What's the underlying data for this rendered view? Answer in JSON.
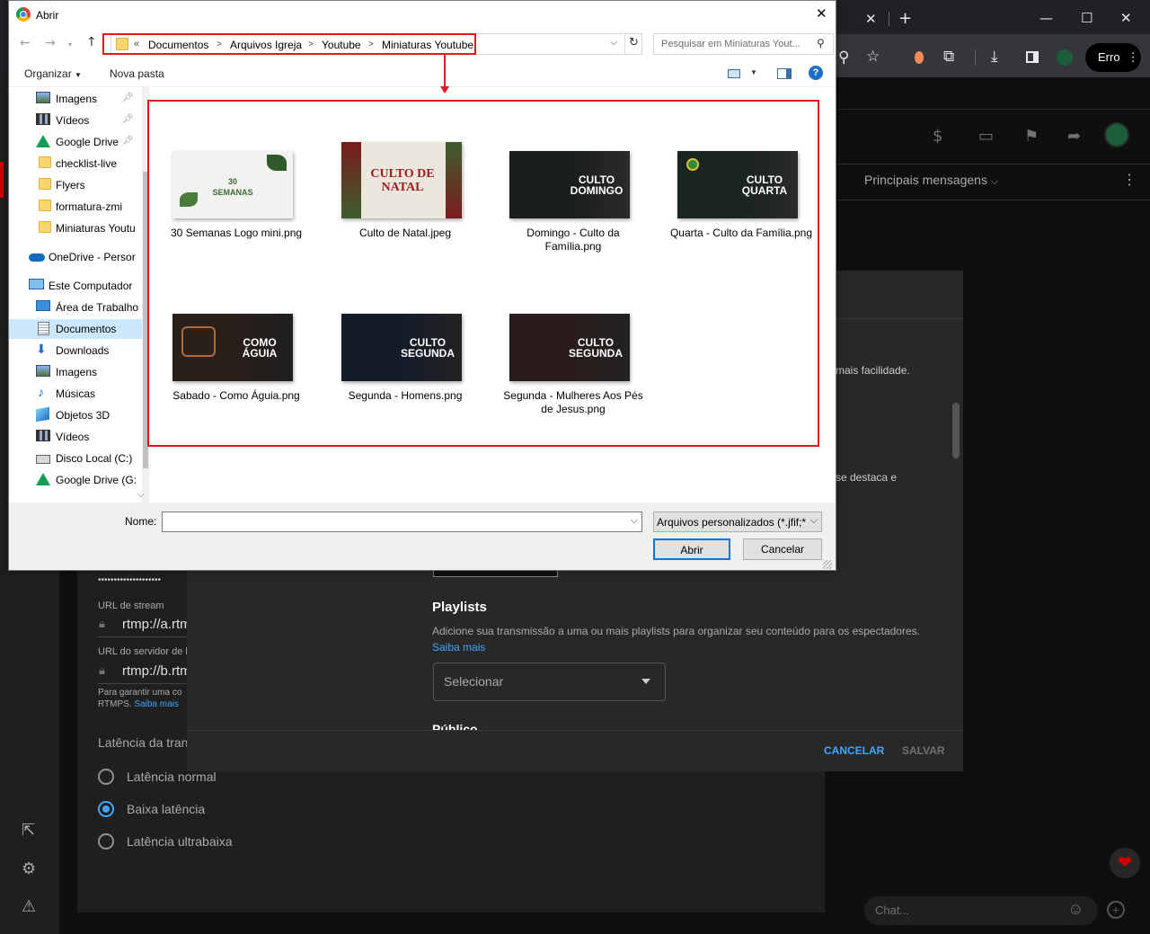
{
  "browser": {
    "window_controls": {
      "close": "✕",
      "new_tab": "+",
      "minimize": "—",
      "maximize": "☐",
      "close_window": "✕"
    },
    "profile_button": "Erro"
  },
  "youtube": {
    "chat_header": "Principais mensagens",
    "partial_text_1": "mais facilidade.",
    "partial_text_2": "se destaca e",
    "stream_key_masked": "••••••••••••••••••••",
    "stream_url_label": "URL de stream",
    "stream_url_value": "rtmp://a.rtm",
    "backup_url_label": "URL do servidor de b",
    "backup_url_value": "rtmp://b.rtm",
    "rtmps_note": "Para garantir uma co",
    "rtmps_note2": "RTMPS.",
    "rtmps_link": "Saiba mais",
    "latency_title": "Latência da tran",
    "latency_options": [
      "Latência normal",
      "Baixa latência",
      "Latência ultrabaixa"
    ],
    "playlists_title": "Playlists",
    "playlists_desc": "Adicione sua transmissão a uma ou mais playlists para organizar seu conteúdo para os espectadores.",
    "playlists_link": "Saiba mais",
    "select_placeholder": "Selecionar",
    "public_partial": "Público",
    "cancel": "CANCELAR",
    "save": "SALVAR",
    "chat_placeholder": "Chat..."
  },
  "dialog": {
    "title": "Abrir",
    "breadcrumb": [
      "Documentos",
      "Arquivos Igreja",
      "Youtube",
      "Miniaturas Youtube"
    ],
    "breadcrumb_prefix": "«",
    "search_placeholder": "Pesquisar em Miniaturas Yout...",
    "organize": "Organizar",
    "new_folder": "Nova pasta",
    "nav_items": [
      {
        "label": "Imagens",
        "icon": "images-icon",
        "pinned": true
      },
      {
        "label": "Vídeos",
        "icon": "videos-icon",
        "pinned": true
      },
      {
        "label": "Google Drive",
        "icon": "google-drive-icon",
        "pinned": true
      },
      {
        "label": "checklist-live",
        "icon": "folder-icon"
      },
      {
        "label": "Flyers",
        "icon": "folder-icon"
      },
      {
        "label": "formatura-zmi",
        "icon": "folder-icon"
      },
      {
        "label": "Miniaturas Youtu",
        "icon": "folder-icon"
      },
      {
        "label": "OneDrive - Persor",
        "icon": "onedrive-icon"
      },
      {
        "label": "Este Computador",
        "icon": "computer-icon"
      },
      {
        "label": "Área de Trabalho",
        "icon": "desktop-icon"
      },
      {
        "label": "Documentos",
        "icon": "documents-icon",
        "selected": true
      },
      {
        "label": "Downloads",
        "icon": "downloads-icon"
      },
      {
        "label": "Imagens",
        "icon": "images-icon"
      },
      {
        "label": "Músicas",
        "icon": "music-icon"
      },
      {
        "label": "Objetos 3D",
        "icon": "objects-3d-icon"
      },
      {
        "label": "Vídeos",
        "icon": "videos-icon"
      },
      {
        "label": "Disco Local (C:)",
        "icon": "drive-icon"
      },
      {
        "label": "Google Drive (G:",
        "icon": "google-drive-icon"
      }
    ],
    "files": [
      {
        "name": "30 Semanas Logo mini.png",
        "thumb_text": "30 SEMANAS"
      },
      {
        "name": "Culto de Natal.jpeg",
        "thumb_text": "CULTO DE NATAL"
      },
      {
        "name": "Domingo - Culto da Família.png",
        "thumb_text": "CULTO DOMINGO"
      },
      {
        "name": "Quarta - Culto da Família.png",
        "thumb_text": "CULTO QUARTA"
      },
      {
        "name": "Sabado - Como Águia.png",
        "thumb_text": "COMO ÁGUIA"
      },
      {
        "name": "Segunda - Homens.png",
        "thumb_text": "CULTO SEGUNDA"
      },
      {
        "name": "Segunda - Mulheres Aos Pés de Jesus.png",
        "thumb_text": "CULTO SEGUNDA"
      }
    ],
    "name_label": "Nome:",
    "name_value": "",
    "filter_value": "Arquivos personalizados (*.jfif;*",
    "open": "Abrir",
    "cancel": "Cancelar"
  },
  "colors": {
    "highlight_box": "#e0181b",
    "accent_blue": "#0078d7",
    "yt_link": "#3ea6ff"
  }
}
